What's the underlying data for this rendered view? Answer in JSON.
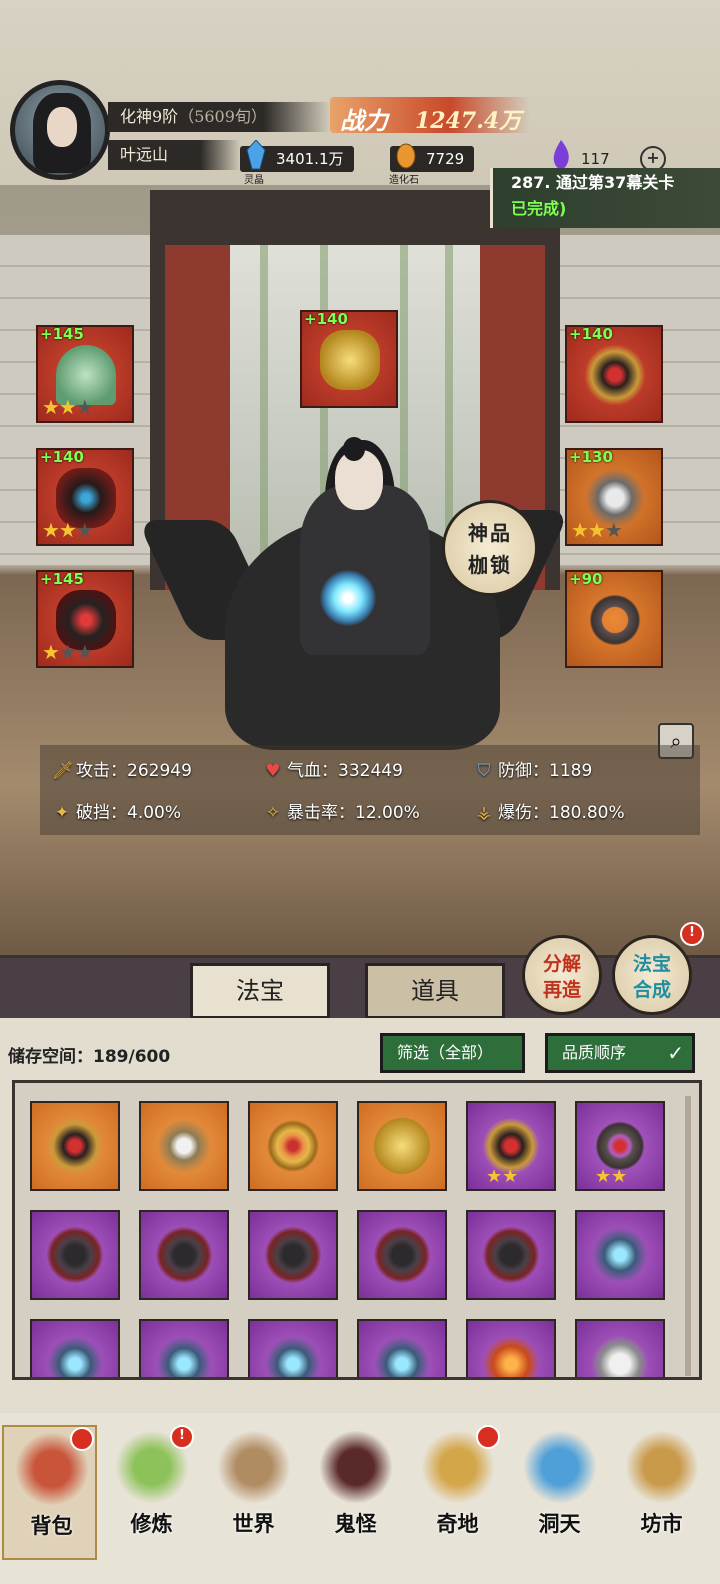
{
  "player": {
    "realm": "化神9阶",
    "age": "（5609旬）",
    "name": "叶远山",
    "power_label": "战力",
    "power_value": "1247.4万"
  },
  "resources": [
    {
      "name": "灵晶",
      "value": "3401.1万",
      "icon": "blue-crystal-icon",
      "color": "#4aa3e8"
    },
    {
      "name": "造化石",
      "value": "7729",
      "icon": "orange-stone-icon",
      "color": "#e8962e"
    },
    {
      "name": "",
      "value": "117",
      "icon": "purple-flame-icon",
      "color": "#7a3fd8"
    }
  ],
  "quest": {
    "line1": "287. 通过第37幕关卡",
    "line2": "已完成)"
  },
  "equipment": [
    {
      "bonus": "+145",
      "stars": 2,
      "icon": "fan-icon",
      "frame": "red"
    },
    {
      "bonus": "+140",
      "stars": 0,
      "icon": "cloud-swirl-icon",
      "frame": "red"
    },
    {
      "bonus": "+140",
      "stars": 0,
      "icon": "gem-ring-icon",
      "frame": "red"
    },
    {
      "bonus": "+140",
      "stars": 2,
      "icon": "robe-armor-icon",
      "frame": "red"
    },
    {
      "bonus": "+130",
      "stars": 2,
      "icon": "pendant-icon",
      "frame": "orange"
    },
    {
      "bonus": "+145",
      "stars": 1,
      "icon": "dark-armor-icon",
      "frame": "red"
    },
    {
      "bonus": "+90",
      "stars": 0,
      "icon": "iron-ring-icon",
      "frame": "orange"
    }
  ],
  "lock_button": "神品\n枷锁",
  "stats": [
    {
      "label": "攻击：",
      "value": "262949",
      "icon": "sword-icon"
    },
    {
      "label": "气血：",
      "value": "332449",
      "icon": "heart-icon"
    },
    {
      "label": "防御：",
      "value": "1189",
      "icon": "shield-icon"
    },
    {
      "label": "破挡：",
      "value": "4.00%",
      "icon": "break-icon"
    },
    {
      "label": "暴击率：",
      "value": "12.00%",
      "icon": "crit-icon"
    },
    {
      "label": "爆伤：",
      "value": "180.80%",
      "icon": "crit-damage-icon"
    }
  ],
  "tabs": [
    "法宝",
    "道具"
  ],
  "round_buttons": {
    "decompose": "分解\n再造",
    "synthesize": "法宝\n合成",
    "synthesize_badge": "!"
  },
  "storage": {
    "label": "储存空间：",
    "count": "189/600",
    "filter": "筛选（全部）",
    "sort": "品质顺序"
  },
  "inventory": [
    {
      "rarity": "orange",
      "icon": "gem-ring-icon",
      "stars": 0
    },
    {
      "rarity": "orange",
      "icon": "pendant-icon",
      "stars": 0
    },
    {
      "rarity": "orange",
      "icon": "gold-ring-icon",
      "stars": 0
    },
    {
      "rarity": "orange",
      "icon": "cloud-swirl-icon",
      "stars": 0
    },
    {
      "rarity": "purple",
      "icon": "gem-ring-icon",
      "stars": 2
    },
    {
      "rarity": "purple",
      "icon": "iron-ring-icon",
      "stars": 2
    },
    {
      "rarity": "purple",
      "icon": "sawblade-icon",
      "stars": 0
    },
    {
      "rarity": "purple",
      "icon": "sawblade-icon",
      "stars": 0
    },
    {
      "rarity": "purple",
      "icon": "sawblade-icon",
      "stars": 0
    },
    {
      "rarity": "purple",
      "icon": "sawblade-icon",
      "stars": 0
    },
    {
      "rarity": "purple",
      "icon": "sawblade-icon",
      "stars": 0
    },
    {
      "rarity": "purple",
      "icon": "bow-icon",
      "stars": 0
    },
    {
      "rarity": "purple",
      "icon": "bow-icon",
      "stars": 0
    },
    {
      "rarity": "purple",
      "icon": "bow-icon",
      "stars": 0
    },
    {
      "rarity": "purple",
      "icon": "bow-icon",
      "stars": 0
    },
    {
      "rarity": "purple",
      "icon": "bow-icon",
      "stars": 0
    },
    {
      "rarity": "purple",
      "icon": "flame-blade-icon",
      "stars": 0
    },
    {
      "rarity": "purple",
      "icon": "white-armor-icon",
      "stars": 0
    }
  ],
  "nav": [
    {
      "label": "背包",
      "icon": "bag-icon",
      "badge": true,
      "color": "#c8543a"
    },
    {
      "label": "修炼",
      "icon": "lotus-icon",
      "badge": true,
      "color": "#8dc25a"
    },
    {
      "label": "世界",
      "icon": "scroll-map-icon",
      "badge": false,
      "color": "#b08c62"
    },
    {
      "label": "鬼怪",
      "icon": "demon-egg-icon",
      "badge": false,
      "color": "#5a2a2a"
    },
    {
      "label": "奇地",
      "icon": "floating-island-icon",
      "badge": true,
      "color": "#d4a64a"
    },
    {
      "label": "洞天",
      "icon": "portal-icon",
      "badge": false,
      "color": "#4fa0d8"
    },
    {
      "label": "坊市",
      "icon": "market-stall-icon",
      "badge": false,
      "color": "#c99a4a"
    }
  ]
}
